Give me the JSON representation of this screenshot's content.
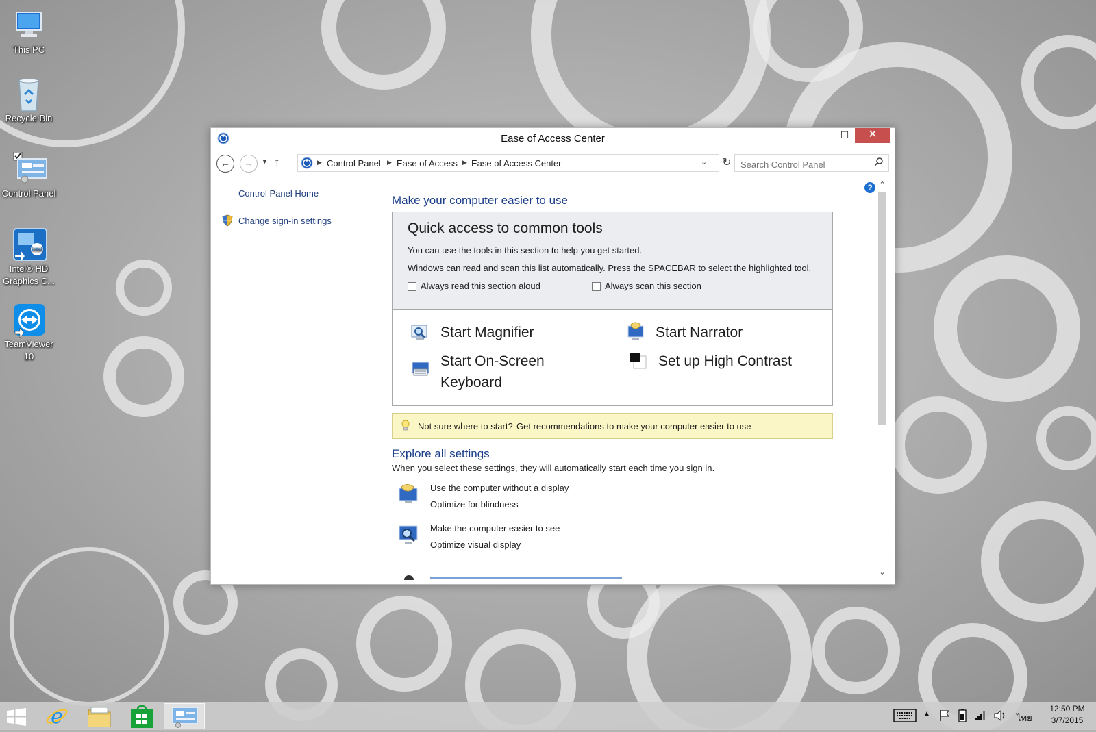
{
  "desktop": {
    "icons": [
      {
        "label": "This PC"
      },
      {
        "label": "Recycle Bin"
      },
      {
        "label": "Control Panel"
      },
      {
        "label_line1": "Intel® HD",
        "label_line2": "Graphics C..."
      },
      {
        "label_line1": "TeamViewer",
        "label_line2": "10"
      }
    ]
  },
  "window": {
    "title": "Ease of Access Center",
    "buttons": {
      "minimize": "—",
      "maximize": "☐",
      "close": "✕"
    },
    "address": {
      "crumbs": [
        "Control Panel",
        "Ease of Access",
        "Ease of Access Center"
      ]
    },
    "search": {
      "placeholder": "Search Control Panel"
    },
    "sidebar": {
      "home": "Control Panel Home",
      "sign_in": "Change sign-in settings"
    },
    "main": {
      "heading": "Make your computer easier to use",
      "quick_access": {
        "title": "Quick access to common tools",
        "line1": "You can use the tools in this section to help you get started.",
        "line2": "Windows can read and scan this list automatically.  Press the SPACEBAR to select the highlighted tool.",
        "checkbox_read": "Always read this section aloud",
        "checkbox_scan": "Always scan this section",
        "tools": {
          "magnifier": "Start Magnifier",
          "narrator": "Start Narrator",
          "osk_line1": "Start On-Screen",
          "osk_line2": "Keyboard",
          "contrast": "Set up High Contrast"
        }
      },
      "tip": {
        "text": "Not sure where to start?",
        "link": "Get recommendations to make your computer easier to use"
      },
      "explore": {
        "heading": "Explore all settings",
        "desc": "When you select these settings, they will automatically start each time you sign in.",
        "items": [
          {
            "link": "Use the computer without a display",
            "desc": "Optimize for blindness"
          },
          {
            "link": "Make the computer easier to see",
            "desc": "Optimize visual display"
          }
        ]
      }
    }
  },
  "taskbar": {
    "language": "ไทย",
    "time": "12:50 PM",
    "date": "3/7/2015"
  },
  "colors": {
    "link": "#1a62c9",
    "close_button": "#c7504f",
    "tip_background": "#fbf6c5",
    "quick_access_background": "#ebedf0"
  }
}
